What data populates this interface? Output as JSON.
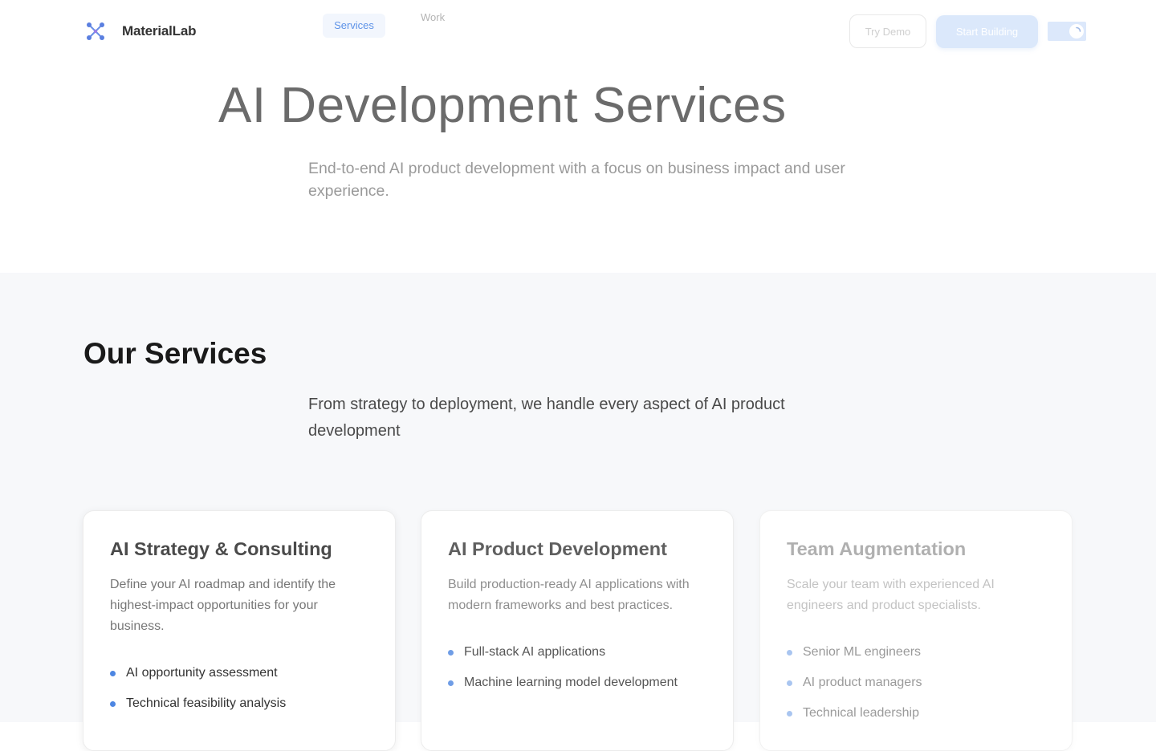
{
  "nav": {
    "brand": "MaterialLab",
    "links": [
      {
        "label": "Services",
        "active": true
      },
      {
        "label": "Work",
        "active": false
      }
    ],
    "try_demo": "Try Demo",
    "start_building": "Start Building",
    "theme_toggle": {
      "state": "on"
    },
    "accent": "#5e93e8"
  },
  "hero": {
    "title": "AI Development Services",
    "subtitle": "End-to-end AI product development with a focus on business impact and user experience."
  },
  "services": {
    "title": "Our Services",
    "subtitle": "From strategy to deployment, we handle every aspect of AI product development",
    "cards": [
      {
        "title": "AI Strategy & Consulting",
        "description": "Define your AI roadmap and identify the highest-impact opportunities for your business.",
        "items": [
          "AI opportunity assessment",
          "Technical feasibility analysis"
        ]
      },
      {
        "title": "AI Product Development",
        "description": "Build production-ready AI applications with modern frameworks and best practices.",
        "items": [
          "Full-stack AI applications",
          "Machine learning model development"
        ]
      },
      {
        "title": "Team Augmentation",
        "description": "Scale your team with experienced AI engineers and product specialists.",
        "items": [
          "Senior ML engineers",
          "AI product managers",
          "Technical leadership"
        ]
      }
    ]
  },
  "icons": {
    "logo": "network-nodes-icon",
    "bullet": "dot-icon",
    "toggle": "spinner-icon"
  }
}
